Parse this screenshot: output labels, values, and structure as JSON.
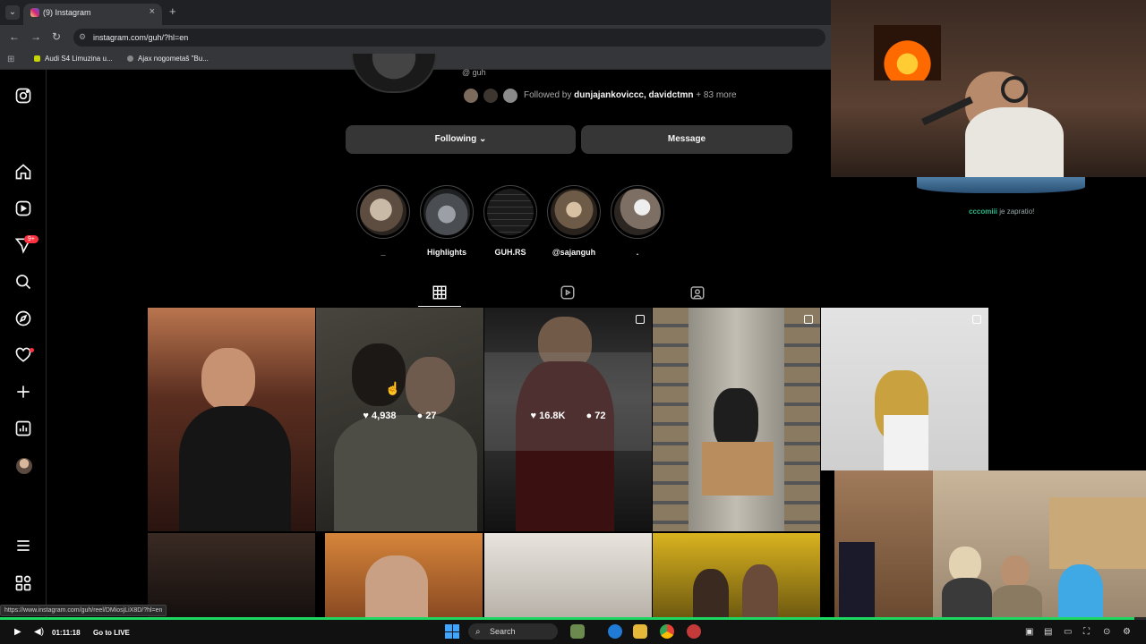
{
  "browser": {
    "tab_title": "(9) Instagram",
    "tab_close": "×",
    "new_tab": "+",
    "url": "instagram.com/guh/?hl=en",
    "bookmarks": [
      "Audi S4 Limuzina u...",
      "Ajax nogometaš \"Bu..."
    ]
  },
  "profile": {
    "username": "@ guh",
    "followed_by_prefix": "Followed by ",
    "followed_by_names": "dunjajankoviccc, davidctmn",
    "followed_by_suffix": " + 83 more",
    "following_button": "Following ⌄",
    "message_button": "Message"
  },
  "highlights": [
    {
      "label": "_",
      "color": "#8a7a6a"
    },
    {
      "label": "Highlights",
      "color": "#6b6e72"
    },
    {
      "label": "GUH.RS",
      "color": "#1b1b1b"
    },
    {
      "label": "@sajanguh",
      "color": "#6d5a47"
    },
    {
      "label": ".",
      "color": "#7d6f63"
    }
  ],
  "posts": [
    {
      "likes": "4,938",
      "comments": "27"
    },
    {
      "likes": "16.8K",
      "comments": "72"
    }
  ],
  "stream": {
    "chat_user": "cccomiii",
    "chat_text": " je zapratio!",
    "status_link": "https://www.instagram.com/guh/reel/DMiosjLiX8D/?hl=en",
    "time": "01:11:18",
    "go_live": "Go to LIVE",
    "search": "Search",
    "progress": 0.99
  },
  "colors": {
    "accent_green": "#1ed760",
    "badge_red": "#ff3040"
  },
  "sidebar": {
    "badge": "9+"
  }
}
